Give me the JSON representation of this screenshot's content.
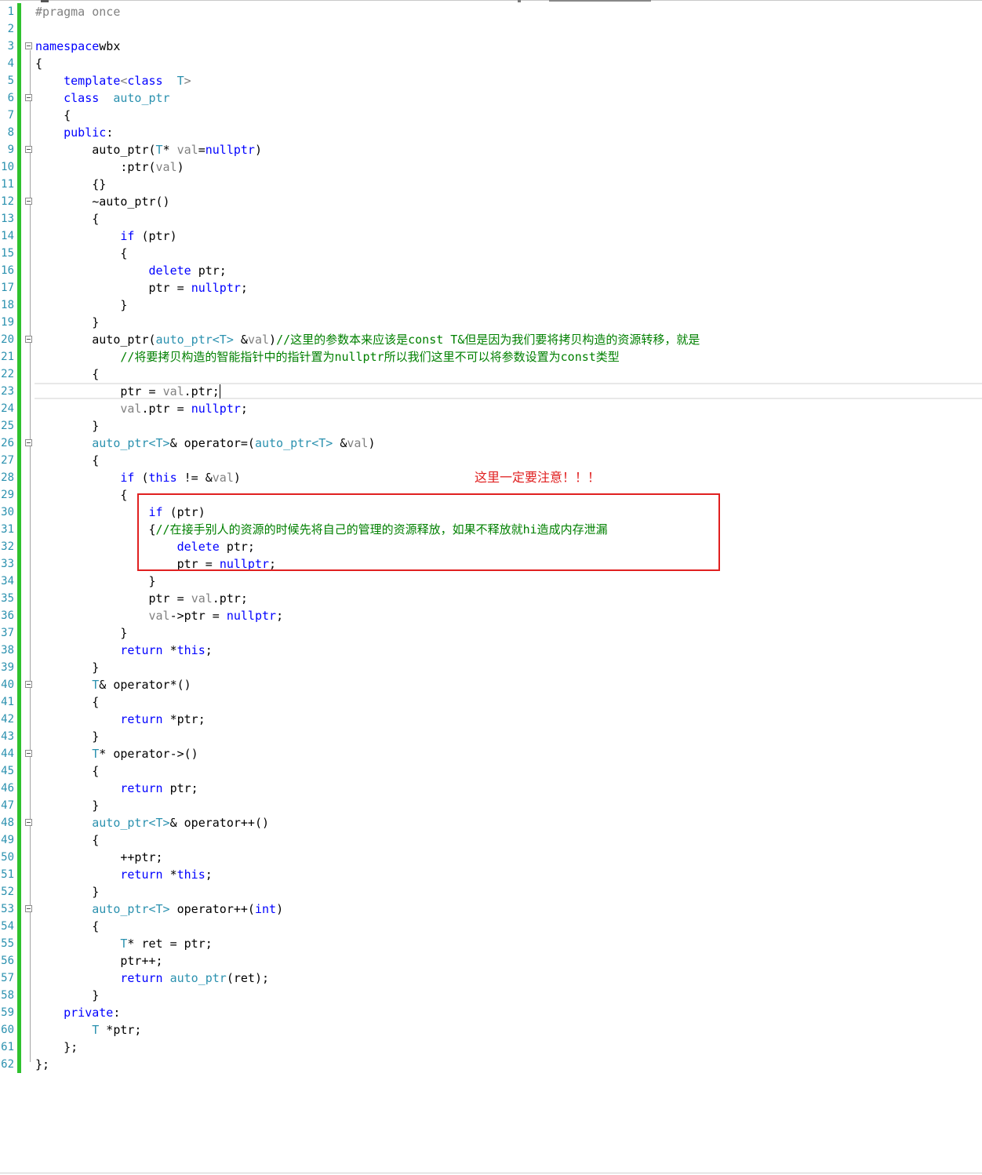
{
  "editor": {
    "language": "C++",
    "colors": {
      "keyword": "#0000ff",
      "type": "#2b91af",
      "comment": "#008000",
      "preprocessor": "#808080",
      "line_number": "#2b91af",
      "change_bar": "#2fc12f",
      "annotation": "#e02020"
    },
    "cursor": {
      "line": 23,
      "after_text": "ptr = val.ptr;"
    },
    "fold_lines": [
      3,
      6,
      9,
      12,
      20,
      26,
      40,
      44,
      48,
      53
    ]
  },
  "code_lines": [
    {
      "n": "1",
      "tokens": [
        [
          "pp",
          "#pragma once"
        ]
      ]
    },
    {
      "n": "2",
      "tokens": []
    },
    {
      "n": "3",
      "tokens": [
        [
          "kw",
          "namespace"
        ],
        [
          "",
          "wbx"
        ]
      ]
    },
    {
      "n": "4",
      "tokens": [
        [
          "",
          "{"
        ]
      ]
    },
    {
      "n": "5",
      "tokens": [
        [
          "",
          "    "
        ],
        [
          "kw",
          "template"
        ],
        [
          "pa",
          "<"
        ],
        [
          "kw",
          "class"
        ],
        [
          "",
          "  "
        ],
        [
          "ty",
          "T"
        ],
        [
          "pa",
          ">"
        ]
      ]
    },
    {
      "n": "6",
      "tokens": [
        [
          "",
          "    "
        ],
        [
          "kw",
          "class"
        ],
        [
          "",
          "  "
        ],
        [
          "ty",
          "auto_ptr"
        ]
      ]
    },
    {
      "n": "7",
      "tokens": [
        [
          "",
          "    {"
        ]
      ]
    },
    {
      "n": "8",
      "tokens": [
        [
          "",
          "    "
        ],
        [
          "kw",
          "public"
        ],
        [
          "",
          ":"
        ]
      ]
    },
    {
      "n": "9",
      "tokens": [
        [
          "",
          "        auto_ptr("
        ],
        [
          "ty",
          "T"
        ],
        [
          "",
          "* "
        ],
        [
          "pa",
          "val"
        ],
        [
          "",
          "="
        ],
        [
          "kw",
          "nullptr"
        ],
        [
          "",
          ")"
        ]
      ]
    },
    {
      "n": "10",
      "tokens": [
        [
          "",
          "            :ptr("
        ],
        [
          "pa",
          "val"
        ],
        [
          "",
          ")"
        ]
      ]
    },
    {
      "n": "11",
      "tokens": [
        [
          "",
          "        {}"
        ]
      ]
    },
    {
      "n": "12",
      "tokens": [
        [
          "",
          "        ~auto_ptr()"
        ]
      ]
    },
    {
      "n": "13",
      "tokens": [
        [
          "",
          "        {"
        ]
      ]
    },
    {
      "n": "14",
      "tokens": [
        [
          "",
          "            "
        ],
        [
          "kw",
          "if"
        ],
        [
          "",
          " (ptr)"
        ]
      ]
    },
    {
      "n": "15",
      "tokens": [
        [
          "",
          "            {"
        ]
      ]
    },
    {
      "n": "16",
      "tokens": [
        [
          "",
          "                "
        ],
        [
          "kw",
          "delete"
        ],
        [
          "",
          " ptr;"
        ]
      ]
    },
    {
      "n": "17",
      "tokens": [
        [
          "",
          "                ptr = "
        ],
        [
          "kw",
          "nullptr"
        ],
        [
          "",
          ";"
        ]
      ]
    },
    {
      "n": "18",
      "tokens": [
        [
          "",
          "            }"
        ]
      ]
    },
    {
      "n": "19",
      "tokens": [
        [
          "",
          "        }"
        ]
      ]
    },
    {
      "n": "20",
      "tokens": [
        [
          "",
          "        auto_ptr("
        ],
        [
          "ty",
          "auto_ptr<T>"
        ],
        [
          "",
          " &"
        ],
        [
          "pa",
          "val"
        ],
        [
          "",
          ")"
        ],
        [
          "cm",
          "//这里的参数本来应该是const T&但是因为我们要将拷贝构造的资源转移，就是"
        ]
      ]
    },
    {
      "n": "21",
      "tokens": [
        [
          "",
          "            "
        ],
        [
          "cm",
          "//将要拷贝构造的智能指针中的指针置为nullptr所以我们这里不可以将参数设置为const类型"
        ]
      ]
    },
    {
      "n": "22",
      "tokens": [
        [
          "",
          "        {"
        ]
      ]
    },
    {
      "n": "23",
      "tokens": [
        [
          "",
          "            ptr = "
        ],
        [
          "pa",
          "val"
        ],
        [
          "",
          ".ptr;"
        ]
      ]
    },
    {
      "n": "24",
      "tokens": [
        [
          "",
          "            "
        ],
        [
          "pa",
          "val"
        ],
        [
          "",
          ".ptr = "
        ],
        [
          "kw",
          "nullptr"
        ],
        [
          "",
          ";"
        ]
      ]
    },
    {
      "n": "25",
      "tokens": [
        [
          "",
          "        }"
        ]
      ]
    },
    {
      "n": "26",
      "tokens": [
        [
          "",
          "        "
        ],
        [
          "ty",
          "auto_ptr<T>"
        ],
        [
          "",
          "& operator=("
        ],
        [
          "ty",
          "auto_ptr<T>"
        ],
        [
          "",
          " &"
        ],
        [
          "pa",
          "val"
        ],
        [
          "",
          ")"
        ]
      ]
    },
    {
      "n": "27",
      "tokens": [
        [
          "",
          "        {"
        ]
      ]
    },
    {
      "n": "28",
      "tokens": [
        [
          "",
          "            "
        ],
        [
          "kw",
          "if"
        ],
        [
          "",
          " ("
        ],
        [
          "kw",
          "this"
        ],
        [
          "",
          " != &"
        ],
        [
          "pa",
          "val"
        ],
        [
          "",
          ")"
        ]
      ]
    },
    {
      "n": "29",
      "tokens": [
        [
          "",
          "            {"
        ]
      ]
    },
    {
      "n": "30",
      "tokens": [
        [
          "",
          "                "
        ],
        [
          "kw",
          "if"
        ],
        [
          "",
          " (ptr)"
        ]
      ]
    },
    {
      "n": "31",
      "tokens": [
        [
          "",
          "                {"
        ],
        [
          "cm",
          "//在接手别人的资源的时候先将自己的管理的资源释放，如果不释放就hi造成内存泄漏"
        ]
      ]
    },
    {
      "n": "32",
      "tokens": [
        [
          "",
          "                    "
        ],
        [
          "kw",
          "delete"
        ],
        [
          "",
          " ptr;"
        ]
      ]
    },
    {
      "n": "33",
      "tokens": [
        [
          "",
          "                    ptr = "
        ],
        [
          "kw",
          "nullptr"
        ],
        [
          "",
          ";"
        ]
      ]
    },
    {
      "n": "34",
      "tokens": [
        [
          "",
          "                }"
        ]
      ]
    },
    {
      "n": "35",
      "tokens": [
        [
          "",
          "                ptr = "
        ],
        [
          "pa",
          "val"
        ],
        [
          "",
          ".ptr;"
        ]
      ]
    },
    {
      "n": "36",
      "tokens": [
        [
          "",
          "                "
        ],
        [
          "pa",
          "val"
        ],
        [
          "",
          "->ptr = "
        ],
        [
          "kw",
          "nullptr"
        ],
        [
          "",
          ";"
        ]
      ]
    },
    {
      "n": "37",
      "tokens": [
        [
          "",
          "            }"
        ]
      ]
    },
    {
      "n": "38",
      "tokens": [
        [
          "",
          "            "
        ],
        [
          "kw",
          "return"
        ],
        [
          "",
          " *"
        ],
        [
          "kw",
          "this"
        ],
        [
          "",
          ";"
        ]
      ]
    },
    {
      "n": "39",
      "tokens": [
        [
          "",
          "        }"
        ]
      ]
    },
    {
      "n": "40",
      "tokens": [
        [
          "",
          "        "
        ],
        [
          "ty",
          "T"
        ],
        [
          "",
          "& operator*()"
        ]
      ]
    },
    {
      "n": "41",
      "tokens": [
        [
          "",
          "        {"
        ]
      ]
    },
    {
      "n": "42",
      "tokens": [
        [
          "",
          "            "
        ],
        [
          "kw",
          "return"
        ],
        [
          "",
          " *ptr;"
        ]
      ]
    },
    {
      "n": "43",
      "tokens": [
        [
          "",
          "        }"
        ]
      ]
    },
    {
      "n": "44",
      "tokens": [
        [
          "",
          "        "
        ],
        [
          "ty",
          "T"
        ],
        [
          "",
          "* operator->()"
        ]
      ]
    },
    {
      "n": "45",
      "tokens": [
        [
          "",
          "        {"
        ]
      ]
    },
    {
      "n": "46",
      "tokens": [
        [
          "",
          "            "
        ],
        [
          "kw",
          "return"
        ],
        [
          "",
          " ptr;"
        ]
      ]
    },
    {
      "n": "47",
      "tokens": [
        [
          "",
          "        }"
        ]
      ]
    },
    {
      "n": "48",
      "tokens": [
        [
          "",
          "        "
        ],
        [
          "ty",
          "auto_ptr<T>"
        ],
        [
          "",
          "& operator++()"
        ]
      ]
    },
    {
      "n": "49",
      "tokens": [
        [
          "",
          "        {"
        ]
      ]
    },
    {
      "n": "50",
      "tokens": [
        [
          "",
          "            ++ptr;"
        ]
      ]
    },
    {
      "n": "51",
      "tokens": [
        [
          "",
          "            "
        ],
        [
          "kw",
          "return"
        ],
        [
          "",
          " *"
        ],
        [
          "kw",
          "this"
        ],
        [
          "",
          ";"
        ]
      ]
    },
    {
      "n": "52",
      "tokens": [
        [
          "",
          "        }"
        ]
      ]
    },
    {
      "n": "53",
      "tokens": [
        [
          "",
          "        "
        ],
        [
          "ty",
          "auto_ptr<T>"
        ],
        [
          "",
          " operator++("
        ],
        [
          "kw",
          "int"
        ],
        [
          "",
          ")"
        ]
      ]
    },
    {
      "n": "54",
      "tokens": [
        [
          "",
          "        {"
        ]
      ]
    },
    {
      "n": "55",
      "tokens": [
        [
          "",
          "            "
        ],
        [
          "ty",
          "T"
        ],
        [
          "",
          "* ret = ptr;"
        ]
      ]
    },
    {
      "n": "56",
      "tokens": [
        [
          "",
          "            ptr++;"
        ]
      ]
    },
    {
      "n": "57",
      "tokens": [
        [
          "",
          "            "
        ],
        [
          "kw",
          "return"
        ],
        [
          "",
          " "
        ],
        [
          "ty",
          "auto_ptr"
        ],
        [
          "",
          "(ret);"
        ]
      ]
    },
    {
      "n": "58",
      "tokens": [
        [
          "",
          "        }"
        ]
      ]
    },
    {
      "n": "59",
      "tokens": [
        [
          "",
          "    "
        ],
        [
          "kw",
          "private"
        ],
        [
          "",
          ":"
        ]
      ]
    },
    {
      "n": "60",
      "tokens": [
        [
          "",
          "        "
        ],
        [
          "ty",
          "T"
        ],
        [
          "",
          " *ptr;"
        ]
      ]
    },
    {
      "n": "61",
      "tokens": [
        [
          "",
          "    };"
        ]
      ]
    },
    {
      "n": "62",
      "tokens": [
        [
          "",
          "};"
        ]
      ]
    }
  ],
  "annotation": {
    "note_text": "这里一定要注意！！！",
    "highlight_lines": [
      30,
      33
    ]
  }
}
